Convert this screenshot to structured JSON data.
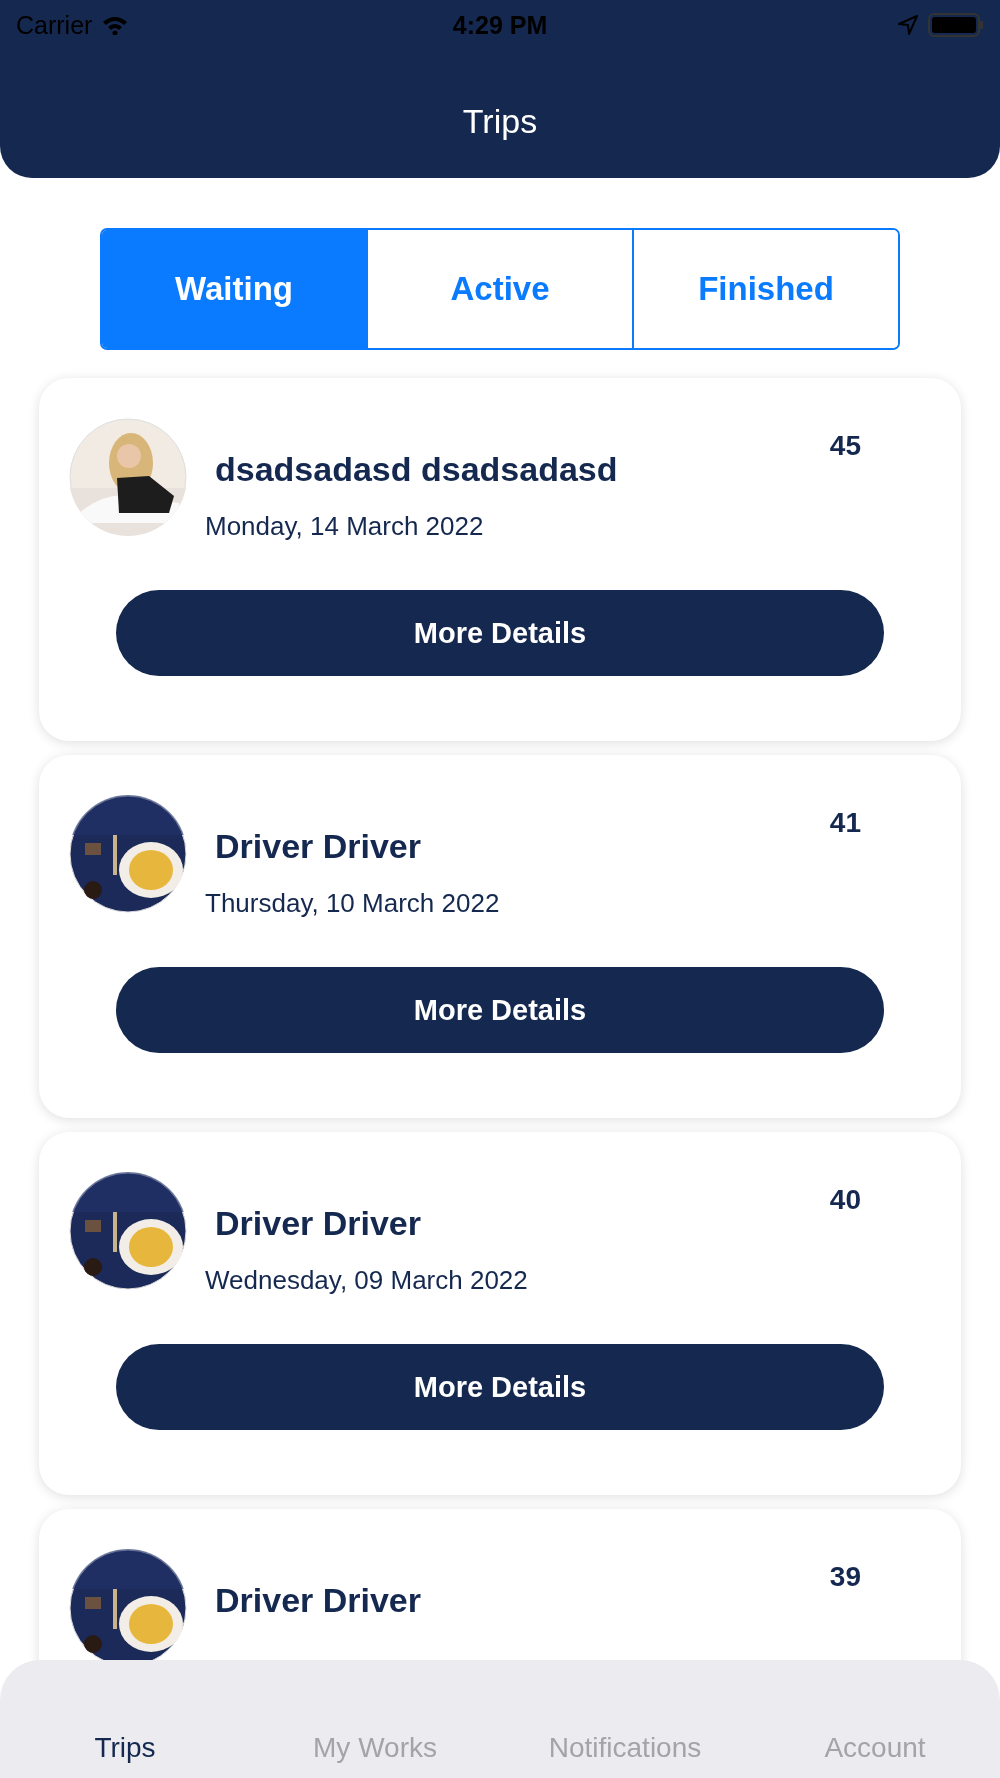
{
  "status_bar": {
    "carrier": "Carrier",
    "time": "4:29 PM"
  },
  "header": {
    "title": "Trips"
  },
  "segments": [
    {
      "label": "Waiting",
      "selected": true
    },
    {
      "label": "Active",
      "selected": false
    },
    {
      "label": "Finished",
      "selected": false
    }
  ],
  "trips": [
    {
      "name": "dsadsadasd dsadsadasd",
      "date": "Monday, 14 March 2022",
      "number": "45",
      "avatar": {
        "kind": "person"
      },
      "button": "More Details"
    },
    {
      "name": "Driver Driver",
      "date": "Thursday, 10 March 2022",
      "number": "41",
      "avatar": {
        "kind": "food"
      },
      "button": "More Details"
    },
    {
      "name": "Driver Driver",
      "date": "Wednesday, 09 March 2022",
      "number": "40",
      "avatar": {
        "kind": "food"
      },
      "button": "More Details"
    },
    {
      "name": "Driver Driver",
      "number": "39",
      "avatar": {
        "kind": "food"
      }
    }
  ],
  "tab_bar": [
    {
      "label": "Trips",
      "selected": true
    },
    {
      "label": "My Works",
      "selected": false
    },
    {
      "label": "Notifications",
      "selected": false
    },
    {
      "label": "Account",
      "selected": false
    }
  ]
}
